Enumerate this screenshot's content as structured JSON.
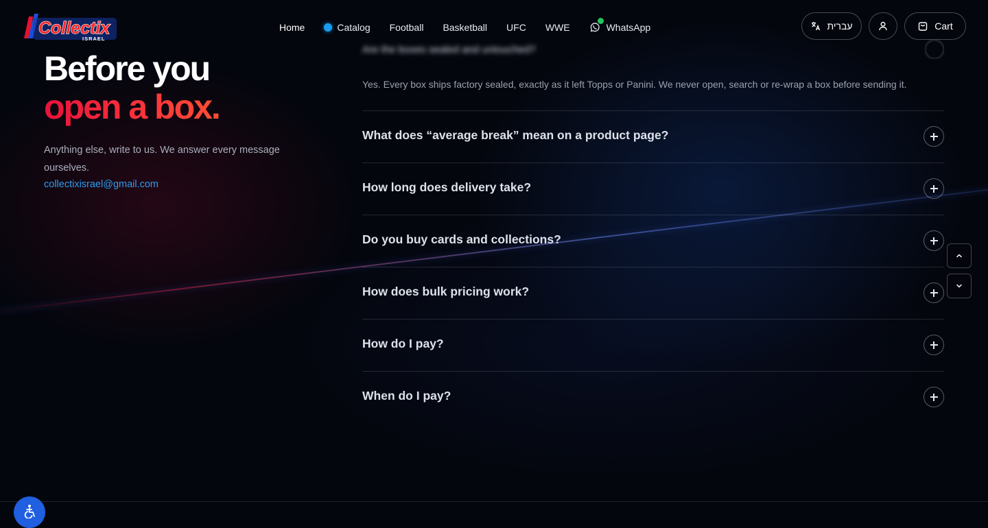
{
  "brand": {
    "name": "Collectix",
    "sub": "ISRAEL"
  },
  "nav": {
    "items": [
      {
        "label": "Home",
        "active": true
      },
      {
        "label": "Catalog",
        "indicator": "blue-dot"
      },
      {
        "label": "Football"
      },
      {
        "label": "Basketball"
      },
      {
        "label": "UFC"
      },
      {
        "label": "WWE"
      },
      {
        "label": "WhatsApp",
        "icon": "whatsapp-icon",
        "badge_color": "#22c55e"
      }
    ]
  },
  "header": {
    "language_label": "עברית",
    "language_icon": "translate-icon",
    "account_icon": "user-icon",
    "cart_label": "Cart",
    "cart_icon": "shopping-bag-icon"
  },
  "hero": {
    "title_line1": "Before you",
    "title_line2": "open a box.",
    "subtitle": "Anything else, write to us. We answer every message ourselves.",
    "email": "collectixisrael@gmail.com"
  },
  "faq": {
    "open_question_blurred": "Are the boxes sealed and untouched?",
    "open_answer": "Yes. Every box ships factory sealed, exactly as it left Topps or Panini. We never open, search or re-wrap a box before sending it.",
    "questions": [
      "What does “average break” mean on a product page?",
      "How long does delivery take?",
      "Do you buy cards and collections?",
      "How does bulk pricing work?",
      "How do I pay?",
      "When do I pay?"
    ]
  },
  "colors": {
    "accent_blue": "#2d9df0",
    "title_gradient_start": "#e8123c",
    "title_gradient_end": "#ff6a2a",
    "background": "#04060d",
    "accessibility_button": "#1f5fe0"
  },
  "widgets": {
    "scroll_up_icon": "chevron-up-icon",
    "scroll_down_icon": "chevron-down-icon",
    "accessibility_icon": "accessibility-icon"
  }
}
